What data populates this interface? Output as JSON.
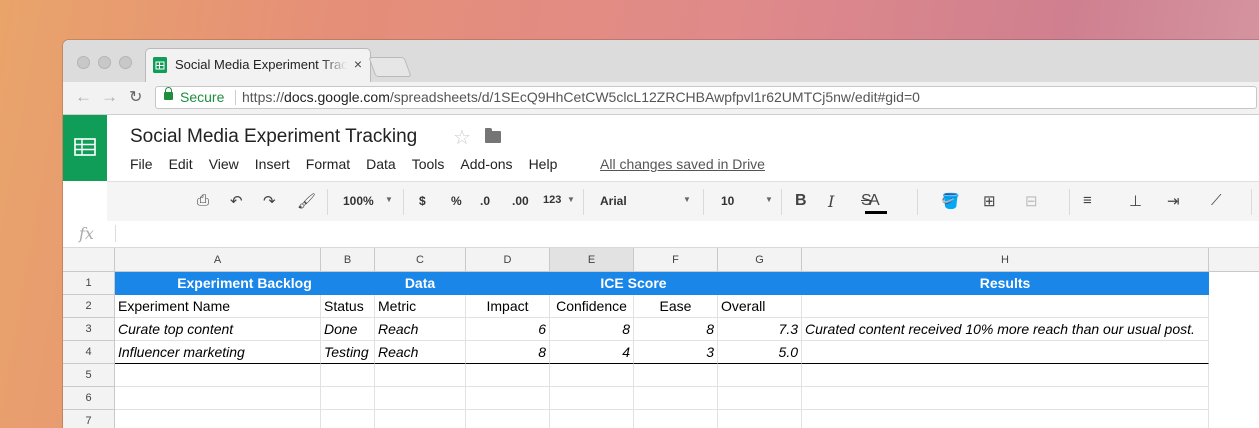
{
  "browser": {
    "tab_title": "Social Media Experiment Tracking",
    "tab_close": "×",
    "secure_label": "Secure",
    "url_scheme": "https://",
    "url_host": "docs.google.com",
    "url_path": "/spreadsheets/d/1SEcQ9HhCetCW5clcL12ZRCHBAwpfpvl1r62UMTCj5nw/edit#gid=0"
  },
  "doc": {
    "title": "Social Media Experiment Tracking",
    "saved_status": "All changes saved in Drive"
  },
  "menu": [
    "File",
    "Edit",
    "View",
    "Insert",
    "Format",
    "Data",
    "Tools",
    "Add-ons",
    "Help"
  ],
  "toolbar": {
    "zoom": "100%",
    "currency": "$",
    "percent": "%",
    "dec_less": ".0",
    "dec_more": ".00",
    "more_formats": "123",
    "font": "Arial",
    "font_size": "10",
    "bold": "B",
    "italic": "I",
    "strike": "S",
    "text_color": "A"
  },
  "formula_bar": {
    "fx_label": "fx"
  },
  "grid": {
    "columns": [
      "A",
      "B",
      "C",
      "D",
      "E",
      "F",
      "G",
      "H"
    ],
    "rows": [
      "1",
      "2",
      "3",
      "4",
      "5",
      "6",
      "7"
    ],
    "headers": {
      "experiment_backlog": "Experiment Backlog",
      "data": "Data",
      "ice_score": "ICE Score",
      "results": "Results"
    },
    "subheaders": [
      "Experiment Name",
      "Status",
      "Metric",
      "Impact",
      "Confidence",
      "Ease",
      "Overall",
      ""
    ],
    "data_rows": [
      [
        "Curate top content",
        "Done",
        "Reach",
        "6",
        "8",
        "8",
        "7.3",
        "Curated content received 10% more reach than our usual post."
      ],
      [
        "Influencer marketing",
        "Testing",
        "Reach",
        "8",
        "4",
        "3",
        "5.0",
        ""
      ]
    ]
  },
  "colors": {
    "header_blue": "#1a86e8",
    "sheets_green": "#0f9d58",
    "secure_green": "#1e8e3e"
  }
}
